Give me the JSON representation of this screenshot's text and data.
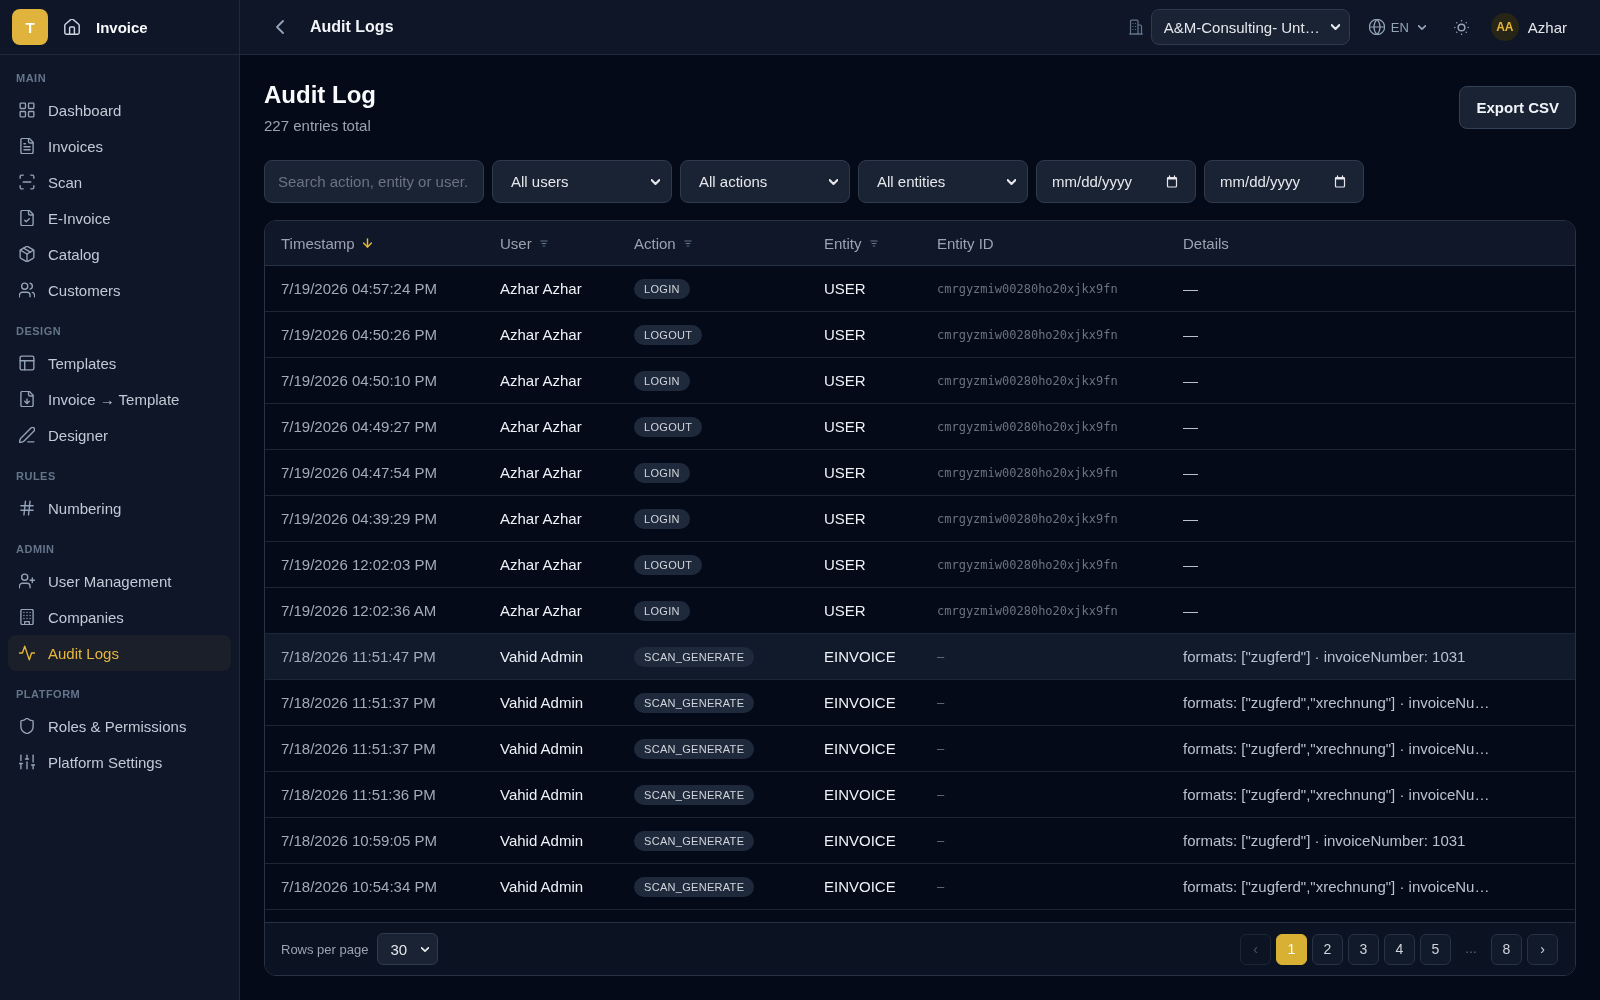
{
  "sidebar": {
    "logo": "T",
    "app_name": "Invoice",
    "sections": [
      {
        "title": "MAIN",
        "items": [
          {
            "label": "Dashboard",
            "selected": false
          },
          {
            "label": "Invoices",
            "selected": false
          },
          {
            "label": "Scan",
            "selected": false
          },
          {
            "label": "E-Invoice",
            "selected": false
          },
          {
            "label": "Catalog",
            "selected": false
          },
          {
            "label": "Customers",
            "selected": false
          }
        ]
      },
      {
        "title": "DESIGN",
        "items": [
          {
            "label": "Templates",
            "selected": false
          },
          {
            "label": "Invoice → Template",
            "selected": false
          },
          {
            "label": "Designer",
            "selected": false
          }
        ]
      },
      {
        "title": "RULES",
        "items": [
          {
            "label": "Numbering",
            "selected": false
          }
        ]
      },
      {
        "title": "ADMIN",
        "items": [
          {
            "label": "User Management",
            "selected": false
          },
          {
            "label": "Companies",
            "selected": false
          },
          {
            "label": "Audit Logs",
            "selected": true
          }
        ]
      },
      {
        "title": "PLATFORM",
        "items": [
          {
            "label": "Roles & Permissions",
            "selected": false
          },
          {
            "label": "Platform Settings",
            "selected": false
          }
        ]
      }
    ]
  },
  "top_bar": {
    "title": "Audit Logs",
    "company": "A&M-Consulting- Unt…",
    "language": "EN",
    "avatar": "AA",
    "user_name": "Azhar"
  },
  "page": {
    "title": "Audit Log",
    "subtitle": "227 entries total",
    "export_button": "Export CSV"
  },
  "filters": {
    "search": {
      "placeholder": "Search action, entity or user."
    },
    "selects": [
      "All users",
      "All actions",
      "All entities"
    ],
    "dates": [
      {
        "placeholder": "mm/dd/yyyy"
      },
      {
        "placeholder": "mm/dd/yyyy"
      }
    ]
  },
  "table": {
    "columns": [
      {
        "label": "Timestamp",
        "sortable": true,
        "sorted": true
      },
      {
        "label": "User",
        "sortable": true,
        "sorted": false
      },
      {
        "label": "Action",
        "sortable": true,
        "sorted": false
      },
      {
        "label": "Entity",
        "sortable": true,
        "sorted": false
      },
      {
        "label": "Entity ID",
        "sortable": false,
        "sorted": false
      },
      {
        "label": "Details",
        "sortable": false,
        "sorted": false
      }
    ],
    "rows": [
      {
        "timestamp": "7/19/2026 04:57:24 PM",
        "user": "Azhar Azhar",
        "action": "LOGIN",
        "entity": "USER",
        "entity_id": "cmrgyzmiw00280ho20xjkx9fn",
        "details": "—",
        "highlighted": false
      },
      {
        "timestamp": "7/19/2026 04:50:26 PM",
        "user": "Azhar Azhar",
        "action": "LOGOUT",
        "entity": "USER",
        "entity_id": "cmrgyzmiw00280ho20xjkx9fn",
        "details": "—",
        "highlighted": false
      },
      {
        "timestamp": "7/19/2026 04:50:10 PM",
        "user": "Azhar Azhar",
        "action": "LOGIN",
        "entity": "USER",
        "entity_id": "cmrgyzmiw00280ho20xjkx9fn",
        "details": "—",
        "highlighted": false
      },
      {
        "timestamp": "7/19/2026 04:49:27 PM",
        "user": "Azhar Azhar",
        "action": "LOGOUT",
        "entity": "USER",
        "entity_id": "cmrgyzmiw00280ho20xjkx9fn",
        "details": "—",
        "highlighted": false
      },
      {
        "timestamp": "7/19/2026 04:47:54 PM",
        "user": "Azhar Azhar",
        "action": "LOGIN",
        "entity": "USER",
        "entity_id": "cmrgyzmiw00280ho20xjkx9fn",
        "details": "—",
        "highlighted": false
      },
      {
        "timestamp": "7/19/2026 04:39:29 PM",
        "user": "Azhar Azhar",
        "action": "LOGIN",
        "entity": "USER",
        "entity_id": "cmrgyzmiw00280ho20xjkx9fn",
        "details": "—",
        "highlighted": false
      },
      {
        "timestamp": "7/19/2026 12:02:03 PM",
        "user": "Azhar Azhar",
        "action": "LOGOUT",
        "entity": "USER",
        "entity_id": "cmrgyzmiw00280ho20xjkx9fn",
        "details": "—",
        "highlighted": false
      },
      {
        "timestamp": "7/19/2026 12:02:36 AM",
        "user": "Azhar Azhar",
        "action": "LOGIN",
        "entity": "USER",
        "entity_id": "cmrgyzmiw00280ho20xjkx9fn",
        "details": "—",
        "highlighted": false
      },
      {
        "timestamp": "7/18/2026 11:51:47 PM",
        "user": "Vahid Admin",
        "action": "SCAN_GENERATE",
        "entity": "EINVOICE",
        "entity_id": "–",
        "details": "formats: [\"zugferd\"] · invoiceNumber: 1031",
        "highlighted": true
      },
      {
        "timestamp": "7/18/2026 11:51:37 PM",
        "user": "Vahid Admin",
        "action": "SCAN_GENERATE",
        "entity": "EINVOICE",
        "entity_id": "–",
        "details": "formats: [\"zugferd\",\"xrechnung\"] · invoiceNu…",
        "highlighted": false
      },
      {
        "timestamp": "7/18/2026 11:51:37 PM",
        "user": "Vahid Admin",
        "action": "SCAN_GENERATE",
        "entity": "EINVOICE",
        "entity_id": "–",
        "details": "formats: [\"zugferd\",\"xrechnung\"] · invoiceNu…",
        "highlighted": false
      },
      {
        "timestamp": "7/18/2026 11:51:36 PM",
        "user": "Vahid Admin",
        "action": "SCAN_GENERATE",
        "entity": "EINVOICE",
        "entity_id": "–",
        "details": "formats: [\"zugferd\",\"xrechnung\"] · invoiceNu…",
        "highlighted": false
      },
      {
        "timestamp": "7/18/2026 10:59:05 PM",
        "user": "Vahid Admin",
        "action": "SCAN_GENERATE",
        "entity": "EINVOICE",
        "entity_id": "–",
        "details": "formats: [\"zugferd\"] · invoiceNumber: 1031",
        "highlighted": false
      },
      {
        "timestamp": "7/18/2026 10:54:34 PM",
        "user": "Vahid Admin",
        "action": "SCAN_GENERATE",
        "entity": "EINVOICE",
        "entity_id": "–",
        "details": "formats: [\"zugferd\",\"xrechnung\"] · invoiceNu…",
        "highlighted": false
      }
    ]
  },
  "footer": {
    "rows_per_page_label": "Rows per page",
    "rows_per_page": "30",
    "previous": {
      "label": "‹",
      "disabled": true
    },
    "pages": [
      {
        "label": "1",
        "kind": "page",
        "selected": true
      },
      {
        "label": "2",
        "kind": "page",
        "selected": false
      },
      {
        "label": "3",
        "kind": "page",
        "selected": false
      },
      {
        "label": "4",
        "kind": "page",
        "selected": false
      },
      {
        "label": "5",
        "kind": "page",
        "selected": false
      },
      {
        "label": "…",
        "kind": "ellipsis",
        "selected": false
      },
      {
        "label": "8",
        "kind": "page",
        "selected": false
      }
    ],
    "next": {
      "label": "›",
      "disabled": false
    }
  }
}
